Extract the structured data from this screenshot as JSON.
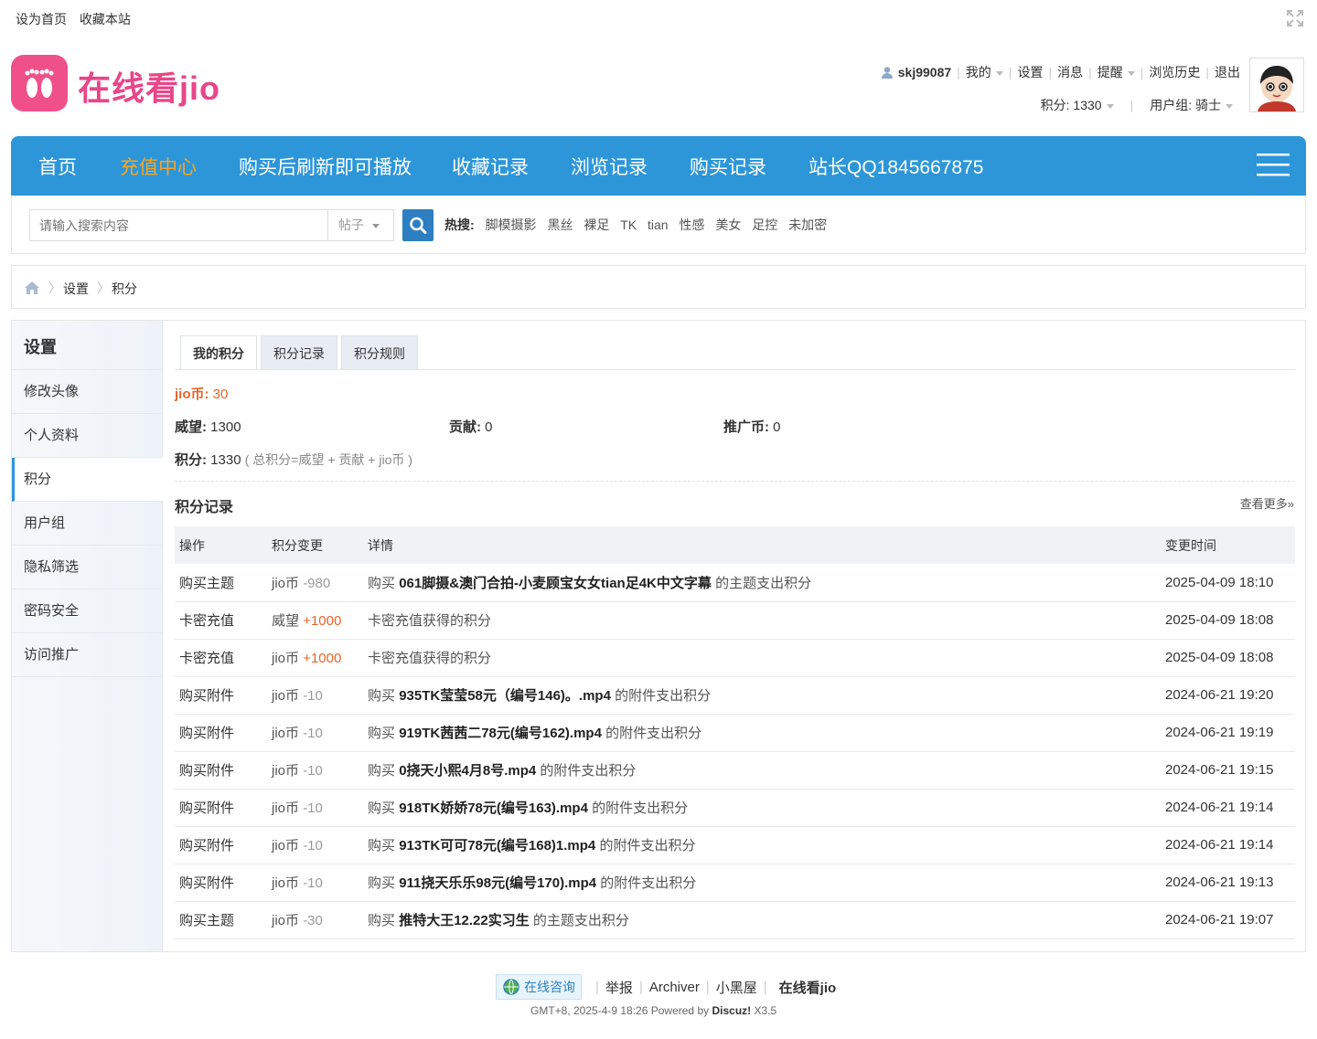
{
  "topbar": {
    "set_home": "设为首页",
    "bookmark": "收藏本站"
  },
  "header": {
    "logo_text": "在线看jio",
    "username": "skj99087",
    "menu": [
      "我的",
      "设置",
      "消息",
      "提醒",
      "浏览历史",
      "退出"
    ],
    "points": "积分: 1330",
    "usergroup": "用户组: 骑士"
  },
  "nav": {
    "items": [
      "首页",
      "充值中心",
      "购买后刷新即可播放",
      "收藏记录",
      "浏览记录",
      "购买记录",
      "站长QQ1845667875"
    ],
    "active_index": 1
  },
  "search": {
    "placeholder": "请输入搜索内容",
    "scope": "帖子",
    "hot_label": "热搜:",
    "hot_terms": [
      "脚模摄影",
      "黑丝",
      "裸足",
      "TK",
      "tian",
      "性感",
      "美女",
      "足控",
      "未加密"
    ]
  },
  "breadcrumb": {
    "items": [
      "设置",
      "积分"
    ]
  },
  "sidebar": {
    "title": "设置",
    "items": [
      "修改头像",
      "个人资料",
      "积分",
      "用户组",
      "隐私筛选",
      "密码安全",
      "访问推广"
    ],
    "active_index": 2
  },
  "tabs": [
    "我的积分",
    "积分记录",
    "积分规则"
  ],
  "credits": {
    "jio_label": "jio币:",
    "jio_value": "30",
    "prestige_label": "威望:",
    "prestige_value": "1300",
    "contribution_label": "贡献:",
    "contribution_value": "0",
    "promo_label": "推广币:",
    "promo_value": "0",
    "total_label": "积分:",
    "total_value": "1330",
    "formula": "( 总积分=威望 + 贡献 + jio币 )"
  },
  "log": {
    "title": "积分记录",
    "more": "查看更多»",
    "headers": [
      "操作",
      "积分变更",
      "详情",
      "变更时间"
    ],
    "rows": [
      {
        "op": "购买主题",
        "unit": "jio币",
        "amount": "-980",
        "sign": "neg",
        "pre": "购买",
        "bold": "061脚摄&澳门合拍-小麦顾宝女女tian足4K中文字幕",
        "post": "的主题支出积分",
        "time": "2025-04-09 18:10"
      },
      {
        "op": "卡密充值",
        "unit": "威望",
        "amount": "+1000",
        "sign": "pos",
        "pre": "",
        "bold": "",
        "post": "卡密充值获得的积分",
        "time": "2025-04-09 18:08"
      },
      {
        "op": "卡密充值",
        "unit": "jio币",
        "amount": "+1000",
        "sign": "pos",
        "pre": "",
        "bold": "",
        "post": "卡密充值获得的积分",
        "time": "2025-04-09 18:08"
      },
      {
        "op": "购买附件",
        "unit": "jio币",
        "amount": "-10",
        "sign": "neg",
        "pre": "购买",
        "bold": "935TK莹莹58元（编号146)。.mp4",
        "post": "的附件支出积分",
        "time": "2024-06-21 19:20"
      },
      {
        "op": "购买附件",
        "unit": "jio币",
        "amount": "-10",
        "sign": "neg",
        "pre": "购买",
        "bold": "919TK茜茜二78元(编号162).mp4",
        "post": "的附件支出积分",
        "time": "2024-06-21 19:19"
      },
      {
        "op": "购买附件",
        "unit": "jio币",
        "amount": "-10",
        "sign": "neg",
        "pre": "购买",
        "bold": "0挠天小熙4月8号.mp4",
        "post": "的附件支出积分",
        "time": "2024-06-21 19:15"
      },
      {
        "op": "购买附件",
        "unit": "jio币",
        "amount": "-10",
        "sign": "neg",
        "pre": "购买",
        "bold": "918TK娇娇78元(编号163).mp4",
        "post": "的附件支出积分",
        "time": "2024-06-21 19:14"
      },
      {
        "op": "购买附件",
        "unit": "jio币",
        "amount": "-10",
        "sign": "neg",
        "pre": "购买",
        "bold": "913TK可可78元(编号168)1.mp4",
        "post": "的附件支出积分",
        "time": "2024-06-21 19:14"
      },
      {
        "op": "购买附件",
        "unit": "jio币",
        "amount": "-10",
        "sign": "neg",
        "pre": "购买",
        "bold": "911挠天乐乐98元(编号170).mp4",
        "post": "的附件支出积分",
        "time": "2024-06-21 19:13"
      },
      {
        "op": "购买主题",
        "unit": "jio币",
        "amount": "-30",
        "sign": "neg",
        "pre": "购买",
        "bold": "推特大王12.22实习生",
        "post": "的主题支出积分",
        "time": "2024-06-21 19:07"
      }
    ]
  },
  "footer": {
    "consult": "在线咨询",
    "links": [
      "举报",
      "Archiver",
      "小黑屋"
    ],
    "brand": "在线看jio",
    "meta_pre": "GMT+8, 2025-4-9 18:26 Powered by",
    "meta_brand": "Discuz!",
    "meta_version": "X3.5"
  },
  "colors": {
    "nav_bg": "#2d96d9",
    "accent_orange": "#f5a623",
    "logo_pink": "#f0508a",
    "credit_orange": "#e8652a"
  }
}
